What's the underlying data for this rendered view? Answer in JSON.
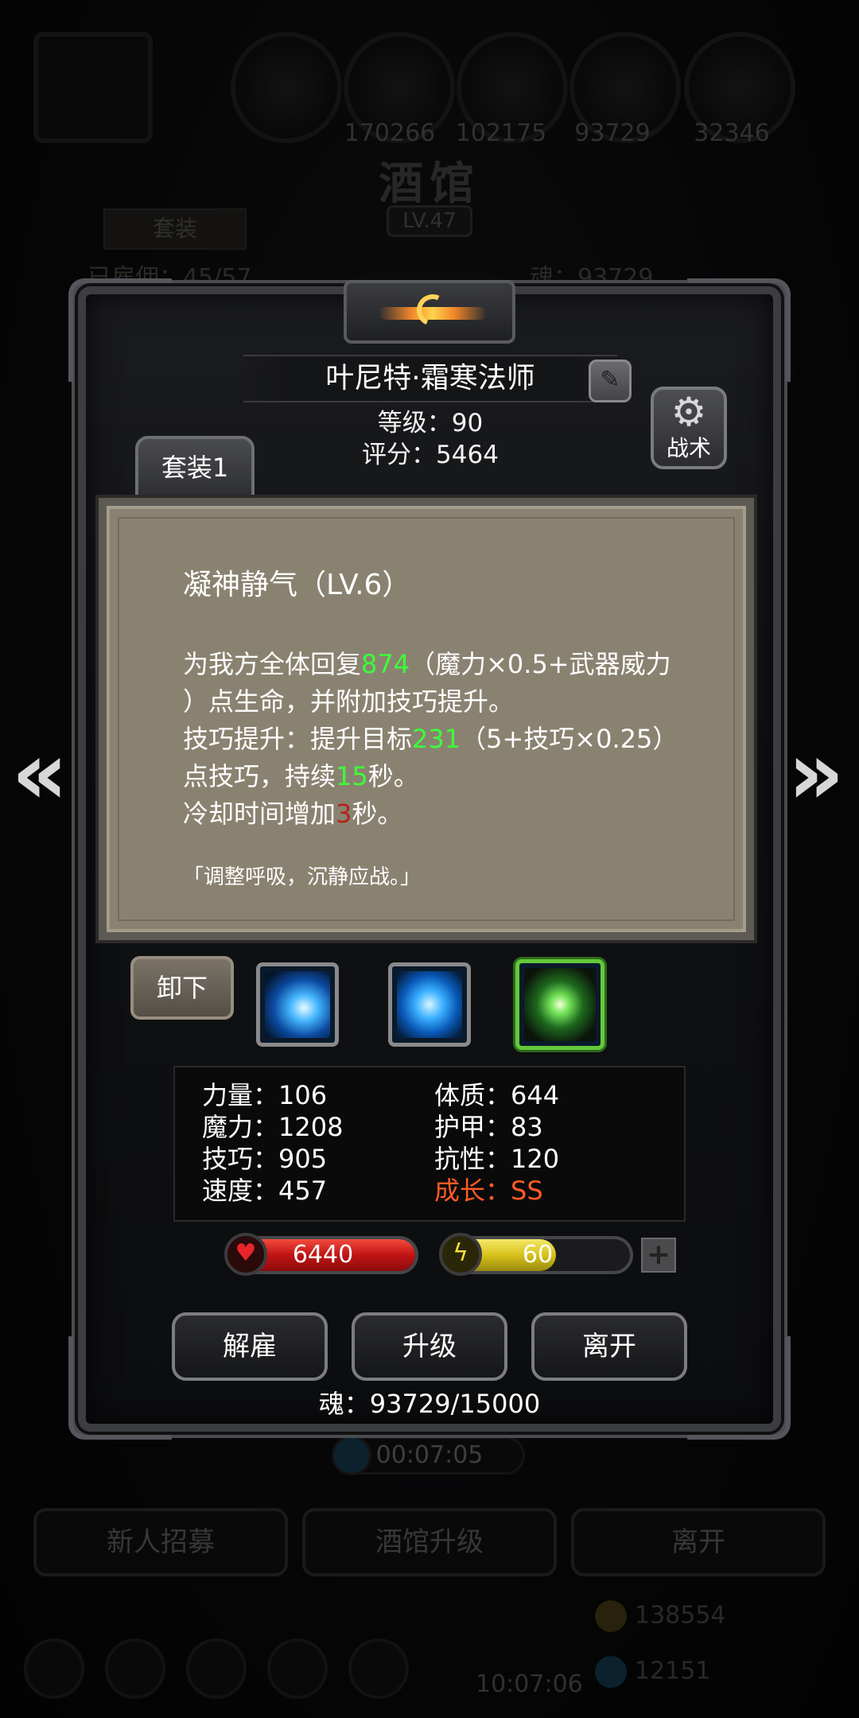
{
  "background": {
    "top_numbers": [
      "170266",
      "102175",
      "93729",
      "32346"
    ],
    "title": "酒馆",
    "level": "LV.47",
    "tab": "套装",
    "roster": "已雇佣：45/57",
    "soul": "魂：93729",
    "timer": "00:07:05",
    "buttons": [
      "新人招募",
      "酒馆升级",
      "离开"
    ],
    "currency": [
      "138554",
      "12151"
    ],
    "clock": "10:07:06"
  },
  "hero": {
    "name": "叶尼特·霜寒法师",
    "level": "等级：90",
    "score": "评分：5464",
    "tactic_label": "战术",
    "set_tab": "套装1"
  },
  "tooltip": {
    "title": "凝神静气（LV.6）",
    "line1_a": "为我方全体回复",
    "line1_val": "874",
    "line1_b": "（魔力×0.5+武器威力",
    "line2": "）点生命，并附加技巧提升。",
    "line3_a": "技巧提升：提升目标",
    "line3_val": "231",
    "line3_b": "（5+技巧×0.25）",
    "line4_a": "点技巧，持续",
    "line4_val": "15",
    "line4_b": "秒。",
    "line5_a": "冷却时间增加",
    "line5_val": "3",
    "line5_b": "秒。",
    "quote": "「调整呼吸，沉静应战。」"
  },
  "skills": {
    "unequip_label": "卸下",
    "slots": [
      "ice-burst-icon",
      "ice-shard-icon",
      "green-spirit-icon"
    ]
  },
  "stats": {
    "str": "力量：106",
    "mag": "魔力：1208",
    "skl": "技巧：905",
    "spd": "速度：457",
    "con": "体质：644",
    "arm": "护甲：83",
    "res": "抗性：120",
    "growth": "成长：SS"
  },
  "bars": {
    "hp": "6440",
    "hp_fill": 1.0,
    "energy": "60",
    "energy_fill": 0.6
  },
  "actions": {
    "dismiss": "解雇",
    "upgrade": "升级",
    "leave": "离开"
  },
  "soul_text": "魂：93729/15000",
  "colors": {
    "highlight_green": "#3dff3a",
    "highlight_red": "#b4221b",
    "growth_orange": "#ff5b24",
    "hp_red": "#d01818",
    "energy_yellow": "#e6d21c",
    "tooltip_bg": "#8a8271"
  }
}
